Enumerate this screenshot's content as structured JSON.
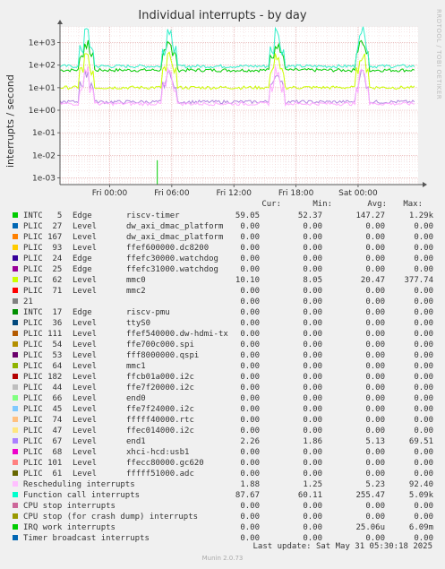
{
  "side_label": "RRDTOOL / TOBI OETIKER",
  "chart_data": {
    "type": "line",
    "title": "Individual interrupts - by day",
    "ylabel": "interrupts / second",
    "yscale": "log",
    "ylim": [
      0.0005,
      5000
    ],
    "y_ticks": [
      "1e+03",
      "1e+02",
      "1e+01",
      "1e+00",
      "1e-01",
      "1e-02",
      "1e-03"
    ],
    "x_ticks": [
      "Fri 00:00",
      "Fri 06:00",
      "Fri 12:00",
      "Fri 18:00",
      "Sat 00:00"
    ],
    "x_hours": [
      0,
      6,
      12,
      18,
      24
    ],
    "xlim_hours": [
      -4.8,
      29.8
    ],
    "grid": true,
    "series": [
      {
        "name": "INTC 5 Edge riscv-timer",
        "color": "#00cc00",
        "base": 59,
        "spike": 1290
      },
      {
        "name": "Function call interrupts",
        "color": "#33f0cc",
        "base": 88,
        "spike": 5090
      },
      {
        "name": "PLIC 62 Level mmc0",
        "color": "#ccff00",
        "base": 10,
        "spike": 378
      },
      {
        "name": "PLIC 67 Level end1",
        "color": "#b085e0",
        "base": 2.3,
        "spike": 70
      },
      {
        "name": "Rescheduling interrupts",
        "color": "#ffaaff",
        "base": 1.9,
        "spike": 92
      }
    ],
    "events_hours": [
      -2.2,
      5.8,
      16.2,
      24.4
    ]
  },
  "legend": {
    "headers": {
      "cur": "Cur:",
      "min": "Min:",
      "avg": "Avg:",
      "max": "Max:"
    },
    "rows": [
      {
        "color": "#00cc00",
        "src": "INTC   5",
        "trig": "Edge",
        "dev": "riscv-timer",
        "cur": "59.05",
        "min": "52.37",
        "avg": "147.27",
        "max": "1.29k"
      },
      {
        "color": "#0066b3",
        "src": "PLIC  27",
        "trig": "Level",
        "dev": "dw_axi_dmac_platform",
        "cur": "0.00",
        "min": "0.00",
        "avg": "0.00",
        "max": "0.00"
      },
      {
        "color": "#ff8000",
        "src": "PLIC 167",
        "trig": "Level",
        "dev": "dw_axi_dmac_platform",
        "cur": "0.00",
        "min": "0.00",
        "avg": "0.00",
        "max": "0.00"
      },
      {
        "color": "#ffcc00",
        "src": "PLIC  93",
        "trig": "Level",
        "dev": "ffef600000.dc8200",
        "cur": "0.00",
        "min": "0.00",
        "avg": "0.00",
        "max": "0.00"
      },
      {
        "color": "#330099",
        "src": "PLIC  24",
        "trig": "Edge",
        "dev": "ffefc30000.watchdog",
        "cur": "0.00",
        "min": "0.00",
        "avg": "0.00",
        "max": "0.00"
      },
      {
        "color": "#990099",
        "src": "PLIC  25",
        "trig": "Edge",
        "dev": "ffefc31000.watchdog",
        "cur": "0.00",
        "min": "0.00",
        "avg": "0.00",
        "max": "0.00"
      },
      {
        "color": "#ccff00",
        "src": "PLIC  62",
        "trig": "Level",
        "dev": "mmc0",
        "cur": "10.10",
        "min": "8.05",
        "avg": "20.47",
        "max": "377.74"
      },
      {
        "color": "#ff0000",
        "src": "PLIC  71",
        "trig": "Level",
        "dev": "mmc2",
        "cur": "0.00",
        "min": "0.00",
        "avg": "0.00",
        "max": "0.00"
      },
      {
        "color": "#808080",
        "src": "21",
        "trig": "",
        "dev": "",
        "cur": "0.00",
        "min": "0.00",
        "avg": "0.00",
        "max": "0.00"
      },
      {
        "color": "#008f00",
        "src": "INTC  17",
        "trig": "Edge",
        "dev": "riscv-pmu",
        "cur": "0.00",
        "min": "0.00",
        "avg": "0.00",
        "max": "0.00"
      },
      {
        "color": "#00487d",
        "src": "PLIC  36",
        "trig": "Level",
        "dev": "ttyS0",
        "cur": "0.00",
        "min": "0.00",
        "avg": "0.00",
        "max": "0.00"
      },
      {
        "color": "#b35a00",
        "src": "PLIC 111",
        "trig": "Level",
        "dev": "ffef540000.dw-hdmi-tx",
        "cur": "0.00",
        "min": "0.00",
        "avg": "0.00",
        "max": "0.00"
      },
      {
        "color": "#b38f00",
        "src": "PLIC  54",
        "trig": "Level",
        "dev": "ffe700c000.spi",
        "cur": "0.00",
        "min": "0.00",
        "avg": "0.00",
        "max": "0.00"
      },
      {
        "color": "#6b006b",
        "src": "PLIC  53",
        "trig": "Level",
        "dev": "fff8000000.qspi",
        "cur": "0.00",
        "min": "0.00",
        "avg": "0.00",
        "max": "0.00"
      },
      {
        "color": "#8fb300",
        "src": "PLIC  64",
        "trig": "Level",
        "dev": "mmc1",
        "cur": "0.00",
        "min": "0.00",
        "avg": "0.00",
        "max": "0.00"
      },
      {
        "color": "#b30000",
        "src": "PLIC 182",
        "trig": "Level",
        "dev": "ffcb01a000.i2c",
        "cur": "0.00",
        "min": "0.00",
        "avg": "0.00",
        "max": "0.00"
      },
      {
        "color": "#bebebe",
        "src": "PLIC  44",
        "trig": "Level",
        "dev": "ffe7f20000.i2c",
        "cur": "0.00",
        "min": "0.00",
        "avg": "0.00",
        "max": "0.00"
      },
      {
        "color": "#80ff80",
        "src": "PLIC  66",
        "trig": "Level",
        "dev": "end0",
        "cur": "0.00",
        "min": "0.00",
        "avg": "0.00",
        "max": "0.00"
      },
      {
        "color": "#80c9ff",
        "src": "PLIC  45",
        "trig": "Level",
        "dev": "ffe7f24000.i2c",
        "cur": "0.00",
        "min": "0.00",
        "avg": "0.00",
        "max": "0.00"
      },
      {
        "color": "#ffc080",
        "src": "PLIC  74",
        "trig": "Level",
        "dev": "fffff40000.rtc",
        "cur": "0.00",
        "min": "0.00",
        "avg": "0.00",
        "max": "0.00"
      },
      {
        "color": "#ffe680",
        "src": "PLIC  47",
        "trig": "Level",
        "dev": "ffec014000.i2c",
        "cur": "0.00",
        "min": "0.00",
        "avg": "0.00",
        "max": "0.00"
      },
      {
        "color": "#aa80ff",
        "src": "PLIC  67",
        "trig": "Level",
        "dev": "end1",
        "cur": "2.26",
        "min": "1.86",
        "avg": "5.13",
        "max": "69.51"
      },
      {
        "color": "#ee00cc",
        "src": "PLIC  68",
        "trig": "Level",
        "dev": "xhci-hcd:usb1",
        "cur": "0.00",
        "min": "0.00",
        "avg": "0.00",
        "max": "0.00"
      },
      {
        "color": "#ff8080",
        "src": "PLIC 101",
        "trig": "Level",
        "dev": "ffecc80000.gc620",
        "cur": "0.00",
        "min": "0.00",
        "avg": "0.00",
        "max": "0.00"
      },
      {
        "color": "#666600",
        "src": "PLIC  61",
        "trig": "Level",
        "dev": "fffff51000.adc",
        "cur": "0.00",
        "min": "0.00",
        "avg": "0.00",
        "max": "0.00"
      },
      {
        "color": "#ffbfff",
        "src": "Rescheduling interrupts",
        "trig": "",
        "dev": "",
        "cur": "1.88",
        "min": "1.25",
        "avg": "5.23",
        "max": "92.40"
      },
      {
        "color": "#00ffcc",
        "src": "Function call interrupts",
        "trig": "",
        "dev": "",
        "cur": "87.67",
        "min": "60.11",
        "avg": "255.47",
        "max": "5.09k"
      },
      {
        "color": "#cc6699",
        "src": "CPU stop interrupts",
        "trig": "",
        "dev": "",
        "cur": "0.00",
        "min": "0.00",
        "avg": "0.00",
        "max": "0.00"
      },
      {
        "color": "#999900",
        "src": "CPU stop (for crash dump) interrupts",
        "trig": "",
        "dev": "",
        "cur": "0.00",
        "min": "0.00",
        "avg": "0.00",
        "max": "0.00"
      },
      {
        "color": "#00cc00",
        "src": "IRQ work interrupts",
        "trig": "",
        "dev": "",
        "cur": "0.00",
        "min": "0.00",
        "avg": "25.06u",
        "max": "6.09m"
      },
      {
        "color": "#0066b3",
        "src": "Timer broadcast interrupts",
        "trig": "",
        "dev": "",
        "cur": "0.00",
        "min": "0.00",
        "avg": "0.00",
        "max": "0.00"
      }
    ]
  },
  "footer": {
    "last_update": "Last update: Sat May 31 05:30:18 2025",
    "version": "Munin 2.0.73"
  }
}
